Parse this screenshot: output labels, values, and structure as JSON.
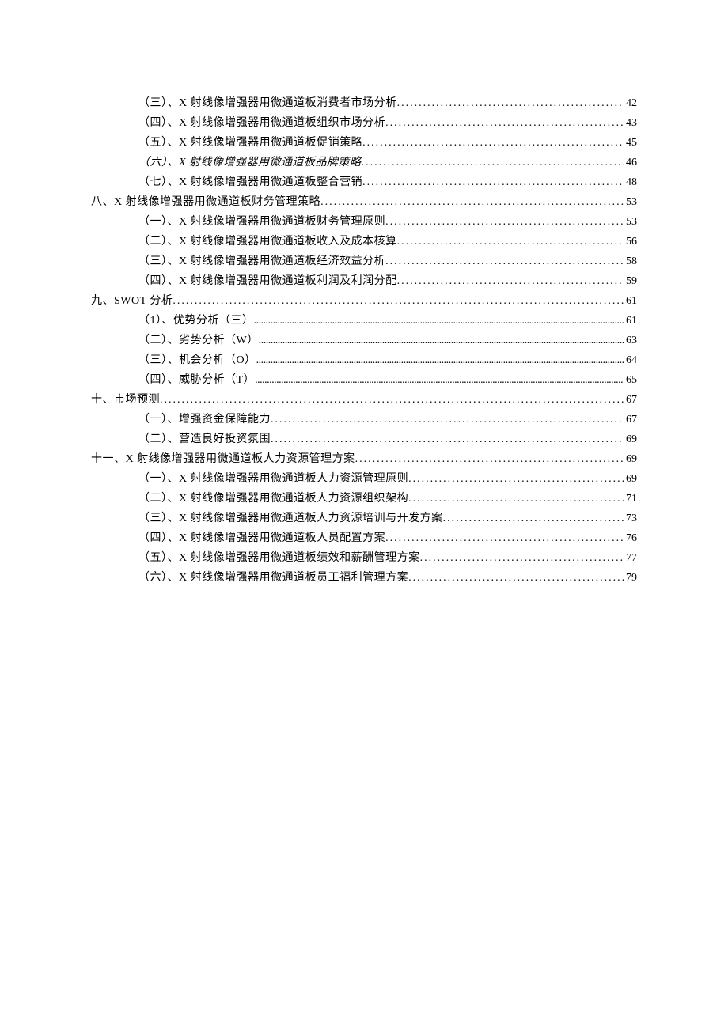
{
  "toc": [
    {
      "indent": 2,
      "label": "（三）、X 射线像增强器用微通道板消费者市场分析",
      "page": "42",
      "dense": false
    },
    {
      "indent": 2,
      "label": "（四）、X 射线像增强器用微通道板组织市场分析",
      "page": "43",
      "dense": false
    },
    {
      "indent": 2,
      "label": "（五）、X 射线像增强器用微通道板促销策略",
      "page": "45",
      "dense": false
    },
    {
      "indent": 2,
      "label": "（六）、X 射线像增强器用微通道板品牌策略",
      "page": "46",
      "dense": false,
      "italic": true
    },
    {
      "indent": 2,
      "label": "（七）、X 射线像增强器用微通道板整合营销",
      "page": "48",
      "dense": false
    },
    {
      "indent": 1,
      "label": "八、X 射线像增强器用微通道板财务管理策略",
      "page": "53",
      "dense": false
    },
    {
      "indent": 2,
      "label": "（一）、X 射线像增强器用微通道板财务管理原则",
      "page": "53",
      "dense": false
    },
    {
      "indent": 2,
      "label": "（二）、X 射线像增强器用微通道板收入及成本核算",
      "page": "56",
      "dense": false
    },
    {
      "indent": 2,
      "label": "（三）、X 射线像增强器用微通道板经济效益分析",
      "page": "58",
      "dense": false
    },
    {
      "indent": 2,
      "label": "（四）、X 射线像增强器用微通道板利润及利润分配",
      "page": "59",
      "dense": false
    },
    {
      "indent": 1,
      "label": "九、SWOT 分析",
      "page": "61",
      "dense": false
    },
    {
      "indent": 2,
      "label": "（1）、优势分析（三）",
      "page": "61",
      "dense": true
    },
    {
      "indent": 2,
      "label": "（二）、劣势分析（W）",
      "page": "63",
      "dense": true
    },
    {
      "indent": 2,
      "label": "（三）、机会分析（O）",
      "page": "64",
      "dense": true
    },
    {
      "indent": 2,
      "label": "（四）、威胁分析（T）",
      "page": "65",
      "dense": true
    },
    {
      "indent": 1,
      "label": "十、市场预测",
      "page": "67",
      "dense": false
    },
    {
      "indent": 2,
      "label": "（一）、增强资金保障能力",
      "page": "67",
      "dense": false
    },
    {
      "indent": 2,
      "label": "（二）、营造良好投资氛围",
      "page": "69",
      "dense": false
    },
    {
      "indent": 1,
      "label": "十一、X 射线像增强器用微通道板人力资源管理方案",
      "page": "69",
      "dense": false
    },
    {
      "indent": 2,
      "label": "（一）、X 射线像增强器用微通道板人力资源管理原则",
      "page": "69",
      "dense": false
    },
    {
      "indent": 2,
      "label": "（二）、X 射线像增强器用微通道板人力资源组织架构",
      "page": "71",
      "dense": false
    },
    {
      "indent": 2,
      "label": "（三）、X 射线像增强器用微通道板人力资源培训与开发方案",
      "page": "73",
      "dense": false
    },
    {
      "indent": 2,
      "label": "（四）、X 射线像增强器用微通道板人员配置方案",
      "page": "76",
      "dense": false
    },
    {
      "indent": 2,
      "label": "（五）、X 射线像增强器用微通道板绩效和薪酬管理方案",
      "page": "77",
      "dense": false
    },
    {
      "indent": 2,
      "label": "（六）、X 射线像增强器用微通道板员工福利管理方案",
      "page": "79",
      "dense": false
    }
  ]
}
